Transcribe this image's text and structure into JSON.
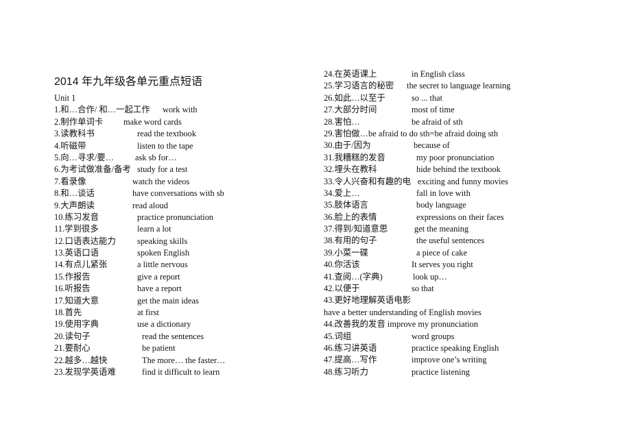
{
  "title": "2014 年九年级各单元重点短语",
  "unit_label": "Unit 1",
  "left_items": [
    {
      "zh": "1.和…合作/  和…一起工作",
      "en": "work with"
    },
    {
      "zh": "2.制作单词卡",
      "en": "make word cards"
    },
    {
      "zh": "3.读教科书",
      "en": "read the textbook"
    },
    {
      "zh": "4.听磁带",
      "en": "listen to the tape"
    },
    {
      "zh": "5.向…寻求/要…",
      "en": "ask sb for…"
    },
    {
      "zh": "6.为考试做准备/备考",
      "en": "study for a test"
    },
    {
      "zh": "7.看录像",
      "en": "watch the videos"
    },
    {
      "zh": "8.和…谈话",
      "en": "have conversations with sb"
    },
    {
      "zh": "9.大声朗读",
      "en": "read aloud"
    },
    {
      "zh": "10.练习发音",
      "en": "practice pronunciation"
    },
    {
      "zh": "11.学到很多",
      "en": "learn a lot"
    },
    {
      "zh": "12.口语表达能力",
      "en": "speaking skills"
    },
    {
      "zh": "13.英语口语",
      "en": "spoken English"
    },
    {
      "zh": "14.有点儿紧张",
      "en": "a little nervous"
    },
    {
      "zh": "15.作报告",
      "en": "give a report"
    },
    {
      "zh": "16.听报告",
      "en": "have a report"
    },
    {
      "zh": "17.知道大意",
      "en": "get the main ideas"
    },
    {
      "zh": "18.首先",
      "en": "at first"
    },
    {
      "zh": "19.使用字典",
      "en": "use a dictionary"
    },
    {
      "zh": "20.读句子",
      "en": "read the sentences"
    },
    {
      "zh": "21.要耐心",
      "en": "be patient"
    },
    {
      "zh": "22.越多…越快",
      "en": "The more… the faster…"
    },
    {
      "zh": "23.发现学英语难",
      "en": "find it difficult to learn"
    }
  ],
  "right_items": [
    {
      "zh": "24.在英语课上",
      "en": "in English class"
    },
    {
      "zh": "25.学习语言的秘密",
      "en": "the secret to language learning"
    },
    {
      "zh": "26.如此…以至于",
      "en": "so ... that"
    },
    {
      "zh": "27.大部分时间",
      "en": "most of time"
    },
    {
      "zh": "28.害怕…",
      "en": "be afraid of sth"
    },
    {
      "full": "29.害怕做…be afraid to do sth=be afraid doing sth"
    },
    {
      "zh": "30.由于/因为",
      "en": "because of"
    },
    {
      "zh": "31.我糟糕的发音",
      "en": "my poor pronunciation"
    },
    {
      "zh": "32.埋头在教科",
      "en": "hide behind the textbook"
    },
    {
      "zh": "33.令人兴奋和有趣的电",
      "en": "exciting and funny movies"
    },
    {
      "zh": "34.爱上…",
      "en": "fall in love with"
    },
    {
      "zh": "35.肢体语言",
      "en": "body language"
    },
    {
      "zh": "36.脸上的表情",
      "en": "expressions on their faces"
    },
    {
      "zh": "37.得到/知道意思",
      "en": "get the meaning"
    },
    {
      "zh": "38.有用的句子",
      "en": "the useful sentences"
    },
    {
      "zh": "39.小菜一碟",
      "en": "a piece of cake"
    },
    {
      "zh": "40.你活该",
      "en": "It serves you right"
    },
    {
      "zh": "41.查阅…(字典)",
      "en": "look up…"
    },
    {
      "zh": "42.以便于",
      "en": "so that"
    },
    {
      "full": "43.更好地理解英语电影"
    },
    {
      "full": "have a better understanding of English movies"
    },
    {
      "full": "44.改善我的发音 improve my pronunciation"
    },
    {
      "zh": "45.词组",
      "en": "word groups"
    },
    {
      "zh": "46.练习讲英语",
      "en": "practice speaking English"
    },
    {
      "zh": "47.提高…写作",
      "en": "improve one’s writing"
    },
    {
      "zh": "48.练习听力",
      "en": "practice listening"
    }
  ]
}
